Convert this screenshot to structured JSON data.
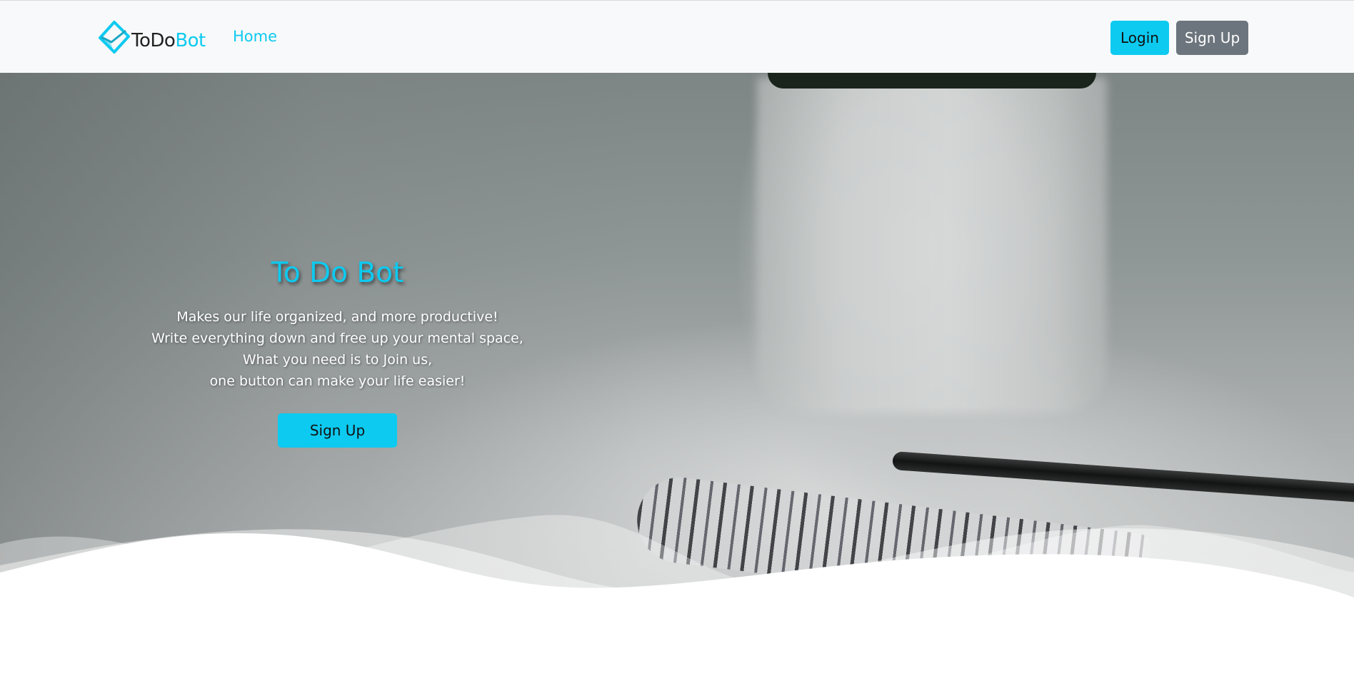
{
  "nav": {
    "logo": {
      "part1": "ToDo",
      "part2": "Bot"
    },
    "home_label": "Home",
    "login_label": "Login",
    "signup_label": "Sign Up"
  },
  "hero": {
    "title": "To Do Bot",
    "lines": [
      "Makes our life organized, and more productive!",
      "Write everything down and free up your mental space,",
      "What you need is to Join us,",
      "one button can make your life easier!"
    ],
    "cta_label": "Sign Up"
  },
  "colors": {
    "accent": "#0dcaf0",
    "secondary": "#6c757d",
    "navbar_bg": "#f8f9fa"
  },
  "icons": {
    "logo": "diamond-check-icon"
  }
}
